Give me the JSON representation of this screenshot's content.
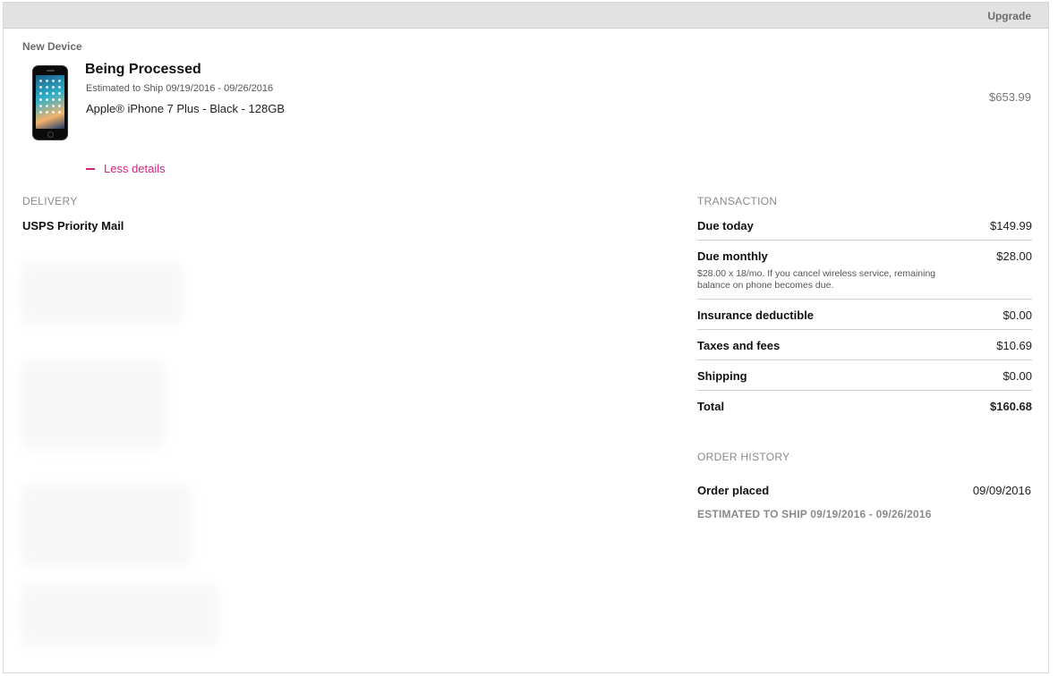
{
  "header": {
    "label": "Upgrade"
  },
  "device_section": {
    "label": "New Device",
    "status_title": "Being Processed",
    "ship_estimate": "Estimated to Ship 09/19/2016 - 09/26/2016",
    "device_name": "Apple® iPhone 7 Plus - Black - 128GB",
    "price": "$653.99",
    "toggle_label": "Less details"
  },
  "delivery": {
    "label": "DELIVERY",
    "method": "USPS Priority Mail"
  },
  "transaction": {
    "label": "TRANSACTION",
    "rows": [
      {
        "name": "Due today",
        "value": "$149.99"
      },
      {
        "name": "Due monthly",
        "value": "$28.00",
        "note": "$28.00 x 18/mo. If you cancel wireless service, remaining balance on phone becomes due."
      },
      {
        "name": "Insurance deductible",
        "value": "$0.00"
      },
      {
        "name": "Taxes and fees",
        "value": "$10.69"
      },
      {
        "name": "Shipping",
        "value": "$0.00"
      },
      {
        "name": "Total",
        "value": "$160.68"
      }
    ]
  },
  "order_history": {
    "label": "ORDER HISTORY",
    "order_placed_label": "Order placed",
    "order_placed_date": "09/09/2016",
    "estimated_ship": "ESTIMATED TO SHIP 09/19/2016 - 09/26/2016"
  },
  "colors": {
    "accent": "#d1257e",
    "header_bg": "#e2e2e2"
  },
  "icons": [
    "phone-image-icon",
    "minus-icon"
  ]
}
